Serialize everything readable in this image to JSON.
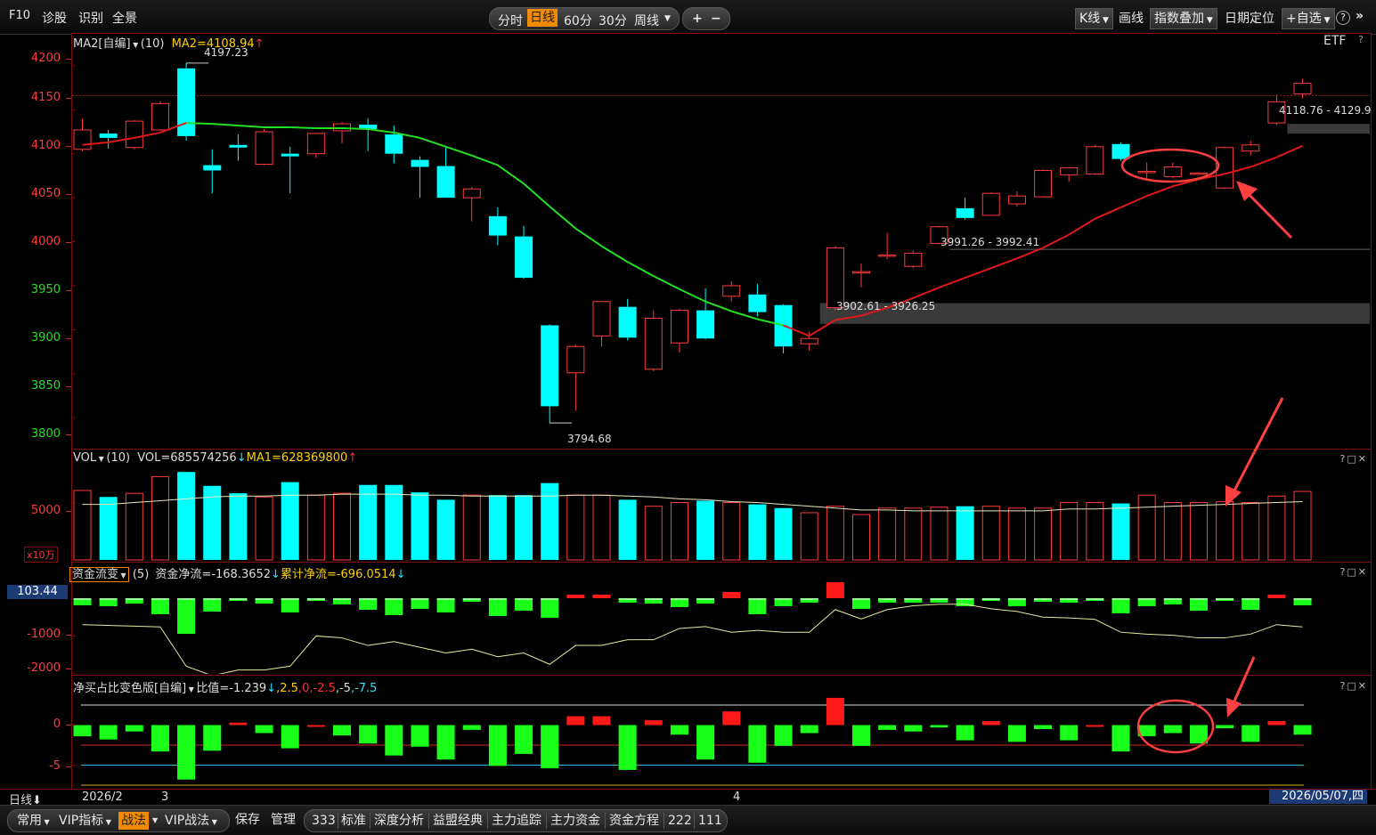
{
  "toolbar": {
    "f10": "F10",
    "diagnose": "诊股",
    "identify": "识别",
    "fullscreen": "全景",
    "periods": [
      "分时",
      "日线",
      "60分",
      "30分",
      "周线"
    ],
    "active_period": "日线",
    "plus": "+",
    "minus": "−",
    "kline": "K线",
    "draw": "画线",
    "index_overlay": "指数叠加",
    "date_locate": "日期定位",
    "add_watchlist": "+自选",
    "help": "?",
    "collapse": "»"
  },
  "price_panel": {
    "header_name": "MA2[自编]",
    "header_param": "(10)",
    "header_value": "MA2=4108.94",
    "etf_label": "ETF",
    "help": "?",
    "y_ticks": [
      "4200",
      "4150",
      "4100",
      "4050",
      "4000",
      "3950",
      "3900",
      "3850",
      "3800"
    ],
    "high_label": "4197.23",
    "low_label": "3794.68",
    "zone_labels": [
      "4118.76 - 4129.9",
      "3991.26 - 3992.41",
      "3902.61 - 3926.25"
    ]
  },
  "vol_panel": {
    "header_name": "VOL",
    "header_param": "(10)",
    "header_vol": "VOL=685574256",
    "header_ma": "MA1=628369800",
    "y_tick": "5000",
    "unit": "x10万"
  },
  "flow_panel": {
    "header_name": "资金流变",
    "header_param": "(5)",
    "header_net": "资金净流=-168.3652",
    "header_cum": "累计净流=-696.0514",
    "current_value": "103.44",
    "y_ticks": [
      "-1000",
      "-2000"
    ]
  },
  "ratio_panel": {
    "header_name": "净买占比变色版[自编]",
    "header_ratio": "比值=-1.239",
    "header_levels": [
      ",2.5",
      ",0",
      ",-2.5",
      ",-5",
      ",-7.5"
    ],
    "y_ticks": [
      "0",
      "-5"
    ]
  },
  "time_axis": {
    "period": "日线",
    "labels": [
      "2026/2",
      "3",
      "4"
    ],
    "current_date": "2026/05/07,四"
  },
  "window_buttons": "?□✕",
  "bottom_bar": {
    "left_tabs": [
      "常用",
      "VIP指标",
      "战法",
      "VIP战法"
    ],
    "active_tab": "战法",
    "actions": [
      "保存",
      "管理"
    ],
    "tools": [
      "333",
      "标准",
      "深度分析",
      "益盟经典",
      "主力追踪",
      "主力资金",
      "资金方程",
      "222",
      "111"
    ]
  },
  "colors": {
    "up": "#ff3b3b",
    "down": "#00ffff",
    "ma_up": "#e01818",
    "ma_down": "#22e022",
    "flow_in": "#ff1a1a",
    "flow_out": "#1aff1a",
    "axis_text": "#ff3b3b",
    "grid": "#7a1010"
  },
  "chart_data": [
    {
      "type": "candlestick",
      "ylim": [
        3780,
        4215
      ],
      "candles": [
        {
          "o": 4105,
          "h": 4140,
          "l": 4103,
          "c": 4127
        },
        {
          "o": 4123,
          "h": 4127,
          "l": 4106,
          "c": 4118
        },
        {
          "o": 4107,
          "h": 4138,
          "l": 4105,
          "c": 4137
        },
        {
          "o": 4127,
          "h": 4160,
          "l": 4126,
          "c": 4157
        },
        {
          "o": 4197,
          "h": 4203,
          "l": 4115,
          "c": 4120
        },
        {
          "o": 4087,
          "h": 4105,
          "l": 4055,
          "c": 4081
        },
        {
          "o": 4110,
          "h": 4122,
          "l": 4092,
          "c": 4107
        },
        {
          "o": 4088,
          "h": 4128,
          "l": 4087,
          "c": 4125
        },
        {
          "o": 4100,
          "h": 4108,
          "l": 4055,
          "c": 4097
        },
        {
          "o": 4100,
          "h": 4122,
          "l": 4095,
          "c": 4123
        },
        {
          "o": 4126,
          "h": 4136,
          "l": 4112,
          "c": 4134
        },
        {
          "o": 4133,
          "h": 4140,
          "l": 4103,
          "c": 4128
        },
        {
          "o": 4122,
          "h": 4132,
          "l": 4089,
          "c": 4100
        },
        {
          "o": 4093,
          "h": 4097,
          "l": 4050,
          "c": 4085
        },
        {
          "o": 4086,
          "h": 4107,
          "l": 4070,
          "c": 4050
        },
        {
          "o": 4050,
          "h": 4062,
          "l": 4023,
          "c": 4060
        },
        {
          "o": 4029,
          "h": 4039,
          "l": 3996,
          "c": 4007
        },
        {
          "o": 4006,
          "h": 4018,
          "l": 3958,
          "c": 3959
        },
        {
          "o": 3905,
          "h": 3906,
          "l": 3794,
          "c": 3813
        },
        {
          "o": 3851,
          "h": 3883,
          "l": 3808,
          "c": 3881
        },
        {
          "o": 3893,
          "h": 3932,
          "l": 3881,
          "c": 3932
        },
        {
          "o": 3926,
          "h": 3935,
          "l": 3888,
          "c": 3891
        },
        {
          "o": 3855,
          "h": 3922,
          "l": 3853,
          "c": 3913
        },
        {
          "o": 3885,
          "h": 3924,
          "l": 3874,
          "c": 3922
        },
        {
          "o": 3922,
          "h": 3947,
          "l": 3889,
          "c": 3890
        },
        {
          "o": 3938,
          "h": 3955,
          "l": 3932,
          "c": 3950
        },
        {
          "o": 3940,
          "h": 3952,
          "l": 3915,
          "c": 3920
        },
        {
          "o": 3928,
          "h": 3929,
          "l": 3873,
          "c": 3881
        },
        {
          "o": 3884,
          "h": 3898,
          "l": 3876,
          "c": 3890
        },
        {
          "o": 3925,
          "h": 3995,
          "l": 3922,
          "c": 3993
        },
        {
          "o": 3965,
          "h": 3975,
          "l": 3948,
          "c": 3966
        },
        {
          "o": 3984,
          "h": 4010,
          "l": 3980,
          "c": 3985
        },
        {
          "o": 3972,
          "h": 3990,
          "l": 3970,
          "c": 3987
        },
        {
          "o": 3998,
          "h": 4018,
          "l": 3997,
          "c": 4017
        },
        {
          "o": 4038,
          "h": 4050,
          "l": 4025,
          "c": 4027
        },
        {
          "o": 4030,
          "h": 4056,
          "l": 4030,
          "c": 4055
        },
        {
          "o": 4043,
          "h": 4057,
          "l": 4040,
          "c": 4052
        },
        {
          "o": 4051,
          "h": 4082,
          "l": 4050,
          "c": 4081
        },
        {
          "o": 4076,
          "h": 4085,
          "l": 4068,
          "c": 4084
        },
        {
          "o": 4077,
          "h": 4110,
          "l": 4076,
          "c": 4108
        },
        {
          "o": 4111,
          "h": 4113,
          "l": 4092,
          "c": 4094
        },
        {
          "o": 4080,
          "h": 4090,
          "l": 4070,
          "c": 4080
        },
        {
          "o": 4074,
          "h": 4090,
          "l": 4072,
          "c": 4085
        },
        {
          "o": 4077,
          "h": 4079,
          "l": 4076,
          "c": 4078
        },
        {
          "o": 4061,
          "h": 4108,
          "l": 4060,
          "c": 4107
        },
        {
          "o": 4103,
          "h": 4115,
          "l": 4098,
          "c": 4110
        },
        {
          "o": 4135,
          "h": 4167,
          "l": 4133,
          "c": 4159
        },
        {
          "o": 4168,
          "h": 4185,
          "l": 4163,
          "c": 4180
        }
      ],
      "ma_series": [
        4110,
        4113,
        4118,
        4124,
        4135,
        4134,
        4132,
        4130,
        4130,
        4129,
        4129,
        4128,
        4124,
        4118,
        4108,
        4098,
        4087,
        4066,
        4040,
        4015,
        3995,
        3977,
        3961,
        3946,
        3932,
        3921,
        3912,
        3905,
        3893,
        3911,
        3916,
        3925,
        3936,
        3948,
        3959,
        3970,
        3981,
        3993,
        4008,
        4026,
        4039,
        4052,
        4063,
        4071,
        4077,
        4085,
        4096,
        4109
      ],
      "ma_down_range": [
        4,
        27
      ],
      "zones": [
        {
          "low": 4118.76,
          "high": 4129.9,
          "from": 46,
          "shade": true
        },
        {
          "low": 3991.26,
          "high": 3992.41,
          "from": 33,
          "shade": false
        },
        {
          "low": 3902.61,
          "high": 3926.25,
          "from": 28,
          "shade": true
        }
      ]
    },
    {
      "type": "bar",
      "name": "VOL",
      "values": [
        75,
        68,
        72,
        90,
        95,
        80,
        72,
        68,
        84,
        70,
        72,
        81,
        81,
        73,
        65,
        70,
        70,
        70,
        83,
        70,
        70,
        65,
        58,
        62,
        64,
        62,
        60,
        56,
        51,
        58,
        49,
        56,
        56,
        57,
        58,
        58,
        56,
        56,
        62,
        62,
        61,
        70,
        62,
        62,
        63,
        62,
        69,
        74
      ],
      "ma": [
        60,
        60,
        62,
        64,
        66,
        68,
        69,
        69,
        70,
        70,
        71,
        71,
        71,
        70,
        70,
        69,
        69,
        69,
        69,
        70,
        70,
        69,
        68,
        66,
        65,
        63,
        62,
        60,
        58,
        56,
        54,
        54,
        53,
        53,
        53,
        53,
        53,
        53,
        55,
        55,
        56,
        57,
        58,
        59,
        60,
        61,
        62,
        63
      ]
    },
    {
      "type": "bar",
      "name": "资金流变",
      "values": [
        -8,
        -9,
        -6,
        -18,
        -40,
        -15,
        -3,
        -6,
        -16,
        -2,
        -7,
        -13,
        -19,
        -12,
        -16,
        -4,
        -20,
        -14,
        -22,
        4,
        4,
        -5,
        -6,
        -10,
        -6,
        7,
        -18,
        -9,
        -5,
        18,
        -12,
        -5,
        -5,
        -5,
        -9,
        -3,
        -9,
        -4,
        -5,
        -3,
        -17,
        -9,
        -7,
        -14,
        -2,
        -13,
        4,
        -8
      ],
      "line": [
        -700,
        -720,
        -740,
        -760,
        -1800,
        -2050,
        -1900,
        -1900,
        -1800,
        -1000,
        -1050,
        -1250,
        -1150,
        -1300,
        -1450,
        -1350,
        -1550,
        -1450,
        -1750,
        -1250,
        -1250,
        -1100,
        -1100,
        -800,
        -750,
        -900,
        -850,
        -900,
        -900,
        -300,
        -550,
        -300,
        -200,
        -160,
        -160,
        -280,
        -350,
        -500,
        -520,
        -560,
        -900,
        -950,
        -980,
        -1050,
        -1050,
        -950,
        -700,
        -760
      ]
    },
    {
      "type": "bar",
      "name": "净买占比",
      "levels": [
        2.5,
        0,
        -2.5,
        -5,
        -7.5
      ],
      "ylim": [
        -7.5,
        3.5
      ],
      "values": [
        -1.4,
        -1.8,
        -0.8,
        -3.3,
        -6.8,
        -3.2,
        0.3,
        -1.0,
        -2.9,
        0.0,
        -1.3,
        -2.3,
        -3.8,
        -2.7,
        -4.3,
        -0.6,
        -5.1,
        -3.6,
        -5.4,
        1.1,
        1.1,
        -5.6,
        0.6,
        -1.2,
        -4.3,
        1.7,
        -4.7,
        -2.6,
        -1.0,
        3.4,
        -2.6,
        -0.6,
        -0.8,
        -0.3,
        -1.9,
        0.5,
        -2.1,
        -0.5,
        -1.9,
        0.0,
        -3.3,
        -1.4,
        -1.0,
        -2.3,
        -0.4,
        -2.1,
        0.5,
        -1.2
      ]
    }
  ]
}
